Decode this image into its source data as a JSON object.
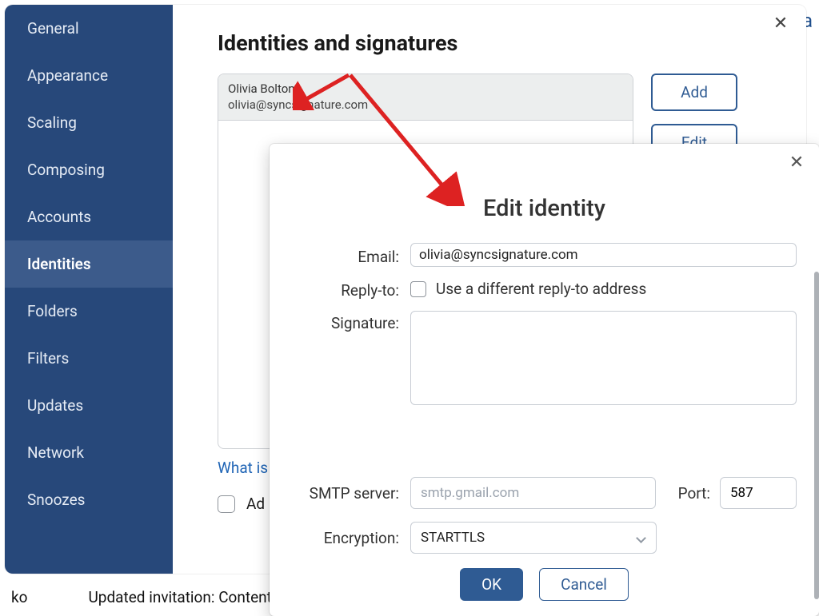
{
  "bg": {
    "day_fragment": "ay, Ja"
  },
  "sidebar": {
    "items": [
      {
        "label": "General"
      },
      {
        "label": "Appearance"
      },
      {
        "label": "Scaling"
      },
      {
        "label": "Composing"
      },
      {
        "label": "Accounts"
      },
      {
        "label": "Identities"
      },
      {
        "label": "Folders"
      },
      {
        "label": "Filters"
      },
      {
        "label": "Updates"
      },
      {
        "label": "Network"
      },
      {
        "label": "Snoozes"
      }
    ],
    "active_index": 5
  },
  "settings": {
    "title": "Identities and signatures",
    "identity": {
      "name": "Olivia Bolton",
      "email": "olivia@syncsignature.com"
    },
    "buttons": {
      "add": "Add",
      "edit": "Edit"
    },
    "what_is": "What is",
    "additional_label": "Ad",
    "footer_left": "ko",
    "footer_right": "Updated invitation: Content S"
  },
  "edit_dialog": {
    "title": "Edit identity",
    "labels": {
      "email": "Email:",
      "reply_to": "Reply-to:",
      "signature": "Signature:",
      "smtp": "SMTP server:",
      "port": "Port:",
      "encryption": "Encryption:"
    },
    "email_value": "olivia@syncsignature.com",
    "reply_to_text": "Use a different reply-to address",
    "smtp_placeholder": "smtp.gmail.com",
    "port_value": "587",
    "encryption_value": "STARTTLS",
    "ok": "OK",
    "cancel": "Cancel"
  }
}
